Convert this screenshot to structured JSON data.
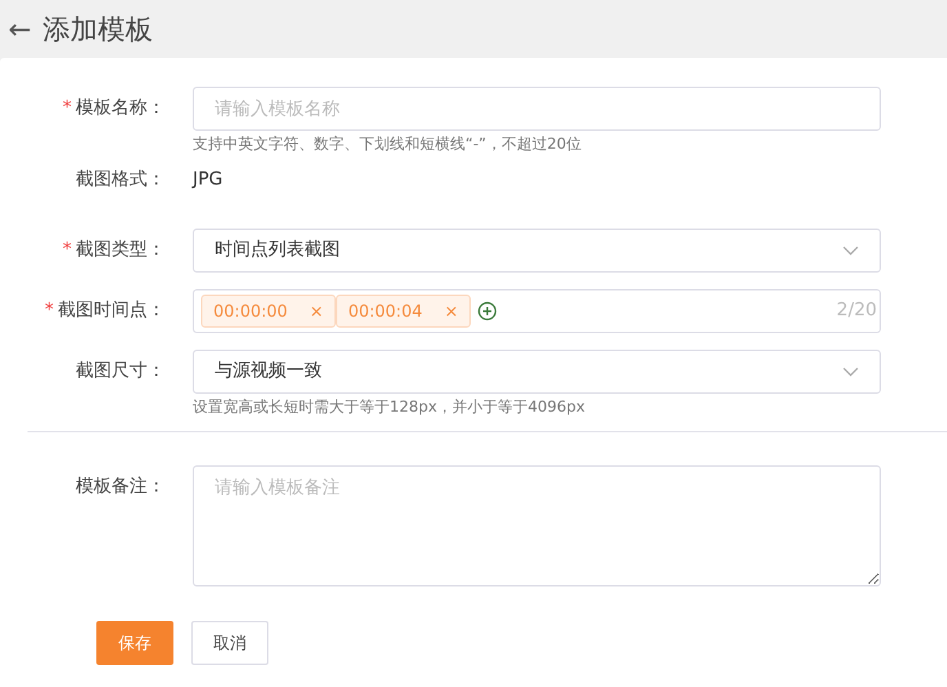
{
  "header": {
    "back_icon": "←",
    "title": "添加模板"
  },
  "required_mark": "*",
  "fields": [
    {
      "kind": "input",
      "label": "模板名称：",
      "required": true,
      "placeholder": "请输入模板名称",
      "hint": "支持中英文字符、数字、下划线和短横线“-”，不超过20位"
    },
    {
      "kind": "static",
      "label": "截图格式：",
      "required": false,
      "value": "JPG"
    },
    {
      "kind": "select",
      "label": "截图类型：",
      "required": true,
      "value": "时间点列表截图"
    },
    {
      "kind": "tags",
      "label": "截图时间点：",
      "required": true,
      "tags": [
        "00:00:00",
        "00:00:04"
      ],
      "remove_icon": "×",
      "count": "2/20"
    },
    {
      "kind": "select",
      "label": "截图尺寸：",
      "required": false,
      "value": "与源视频一致",
      "hint": "设置宽高或长短时需大于等于128px，并小于等于4096px"
    },
    {
      "kind": "divider"
    },
    {
      "kind": "textarea",
      "label": "模板备注：",
      "required": false,
      "placeholder": "请输入模板备注"
    }
  ],
  "buttons": [
    {
      "kind": "primary",
      "label": "保存"
    },
    {
      "kind": "secondary",
      "label": "取消"
    }
  ]
}
